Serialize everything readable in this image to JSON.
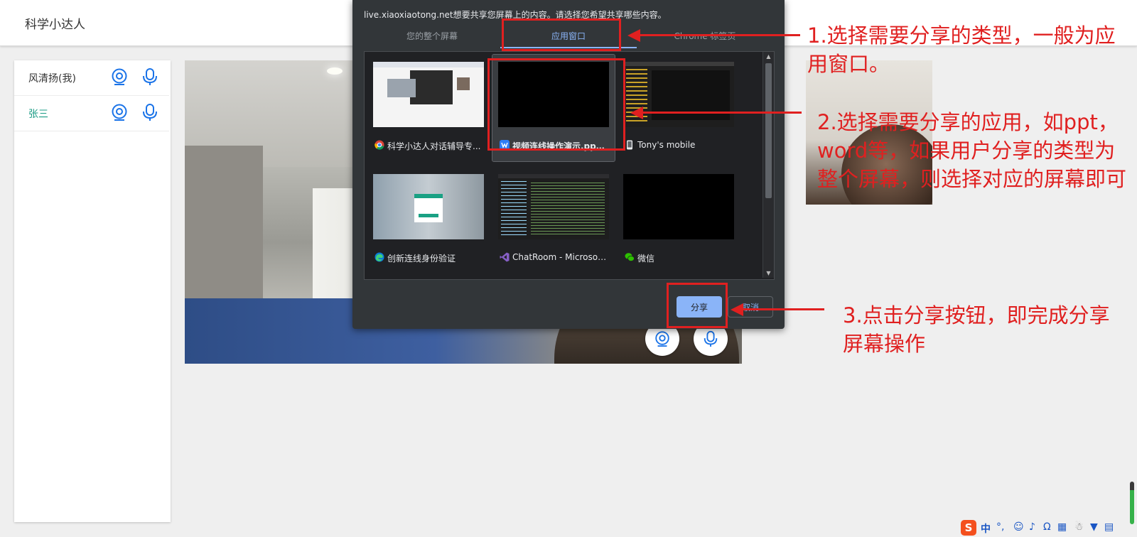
{
  "app": {
    "title": "科学小达人"
  },
  "participants": [
    {
      "name": "风清扬(我)"
    },
    {
      "name": "张三"
    }
  ],
  "dialog": {
    "message": "live.xiaoxiaotong.net想要共享您屏幕上的内容。请选择您希望共享哪些内容。",
    "tabs": [
      "您的整个屏幕",
      "应用窗口",
      "Chrome 标签页"
    ],
    "active_tab": "应用窗口",
    "windows": [
      {
        "label": "科学小达人对话辅导专...",
        "icon": "chrome-icon"
      },
      {
        "label": "视频连线操作演示.ppt...",
        "icon": "wps-icon",
        "selected": true
      },
      {
        "label": "Tony's mobile",
        "icon": "phone-icon"
      },
      {
        "label": "创新连线身份验证",
        "icon": "edge-icon"
      },
      {
        "label": "ChatRoom - Microsoft...",
        "icon": "visual-studio-icon"
      },
      {
        "label": "微信",
        "icon": "wechat-icon"
      }
    ],
    "share_label": "分享",
    "cancel_label": "取消"
  },
  "annotations": {
    "step1": "1.选择需要分享的类型，一般为应用窗口。",
    "step2": "2.选择需要分享的应用，如ppt，word等，如果用户分享的类型为整个屏幕，则选择对应的屏幕即可",
    "step3": "3.点击分享按钮，即完成分享屏幕操作"
  },
  "taskbar": {
    "ime_label": "中"
  },
  "colors": {
    "accent_blue": "#1a73e8",
    "teal_name": "#1a9b85",
    "annotation_red": "#e02020",
    "dialog_bg": "#323639",
    "share_blue": "#8ab4f8"
  }
}
